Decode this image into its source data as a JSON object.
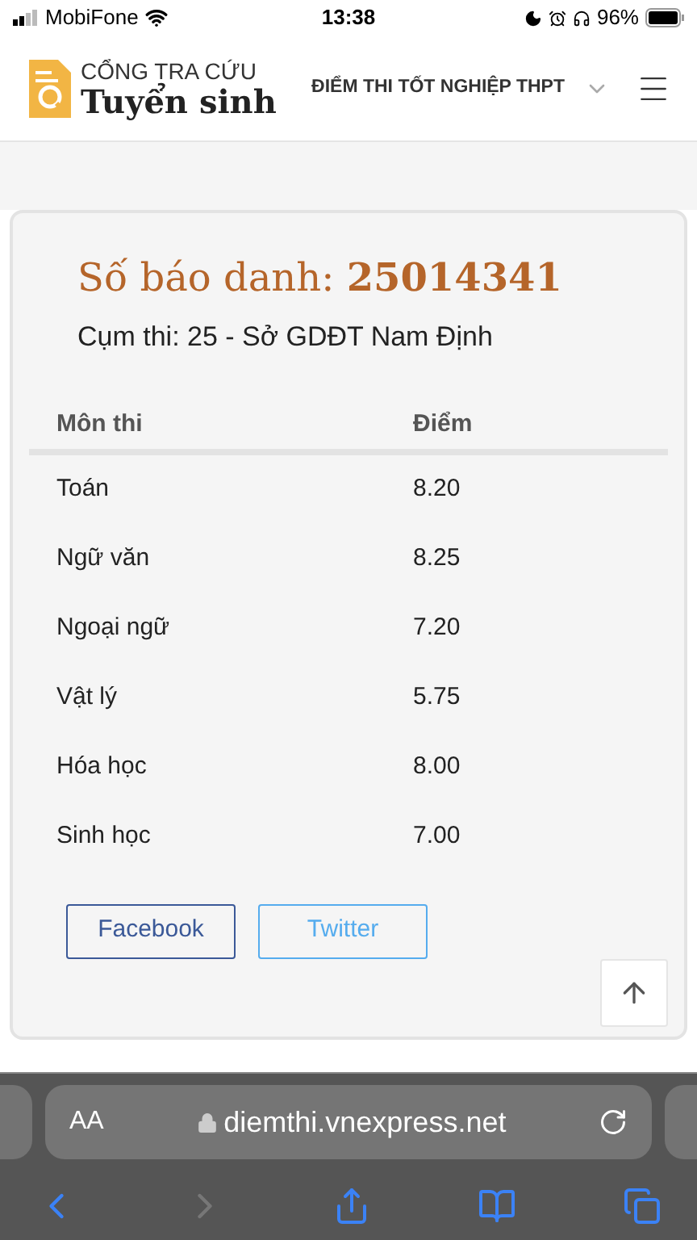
{
  "status_bar": {
    "carrier": "MobiFone",
    "time": "13:38",
    "battery": "96%"
  },
  "header": {
    "logo_top": "CỔNG TRA CỨU",
    "logo_bottom": "Tuyển sinh",
    "section": "ĐIỂM THI TỐT NGHIỆP THPT"
  },
  "result": {
    "id_label": "Số báo danh:",
    "id_value": "25014341",
    "cluster": "Cụm thi: 25 - Sở GDĐT Nam Định",
    "columns": [
      "Môn thi",
      "Điểm"
    ],
    "rows": [
      [
        "Toán",
        "8.20"
      ],
      [
        "Ngữ văn",
        "8.25"
      ],
      [
        "Ngoại ngữ",
        "7.20"
      ],
      [
        "Vật lý",
        "5.75"
      ],
      [
        "Hóa học",
        "8.00"
      ],
      [
        "Sinh học",
        "7.00"
      ]
    ],
    "share_buttons": [
      {
        "label": "Facebook",
        "kind": "facebook"
      },
      {
        "label": "Twitter",
        "kind": "twitter"
      }
    ]
  },
  "browser": {
    "text_size": "AA",
    "url": "diemthi.vnexpress.net",
    "forward_disabled": true
  }
}
